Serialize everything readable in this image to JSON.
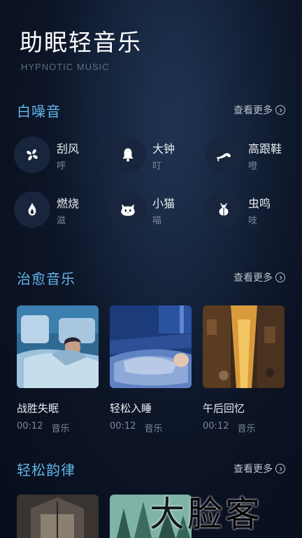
{
  "header": {
    "title": "助眠轻音乐",
    "subtitle": "HYPNOTIC MUSIC"
  },
  "white_noise": {
    "title": "白噪音",
    "more": "查看更多",
    "items": [
      {
        "name": "刮风",
        "sub": "呼",
        "icon": "fan-icon"
      },
      {
        "name": "大钟",
        "sub": "叮",
        "icon": "bell-icon"
      },
      {
        "name": "高跟鞋",
        "sub": "噔",
        "icon": "high-heel-icon"
      },
      {
        "name": "燃烧",
        "sub": "滋",
        "icon": "flame-icon"
      },
      {
        "name": "小猫",
        "sub": "喵",
        "icon": "cat-icon"
      },
      {
        "name": "虫鸣",
        "sub": "吱",
        "icon": "bug-icon"
      }
    ]
  },
  "healing": {
    "title": "治愈音乐",
    "more": "查看更多",
    "cards": [
      {
        "title": "战胜失眠",
        "duration": "00:12",
        "tag": "音乐"
      },
      {
        "title": "轻松入睡",
        "duration": "00:12",
        "tag": "音乐"
      },
      {
        "title": "午后回忆",
        "duration": "00:12",
        "tag": "音乐"
      }
    ]
  },
  "rhythm": {
    "title": "轻松韵律",
    "more": "查看更多"
  },
  "watermark": "大脸客",
  "colors": {
    "accent": "#62b6ea",
    "icon_bg": "#18253d",
    "background": "#0b1322"
  }
}
